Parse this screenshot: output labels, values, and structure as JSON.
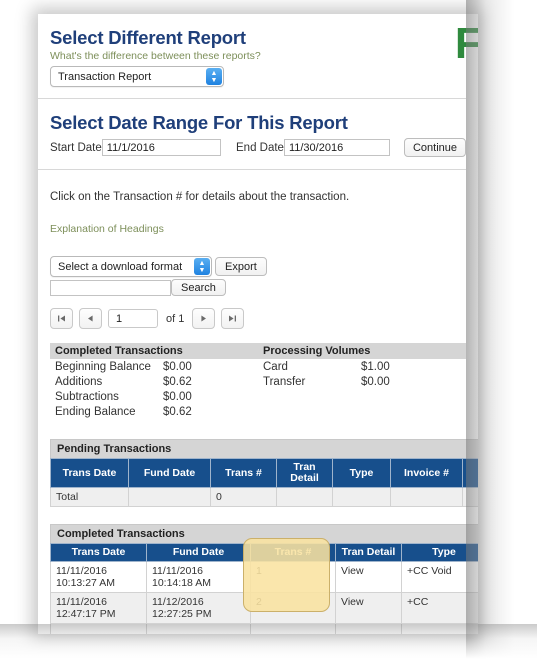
{
  "logo": {
    "text": "Fi"
  },
  "report_selector": {
    "heading": "Select Different Report",
    "help_link": "What's the difference between these reports?",
    "selected_report": "Transaction Report"
  },
  "date_range": {
    "heading": "Select Date Range For This Report",
    "start_label": "Start Date",
    "start_value": "11/1/2016",
    "end_label": "End Date",
    "end_value": "11/30/2016",
    "continue_label": "Continue"
  },
  "instruction": "Click on the Transaction # for details about the transaction.",
  "explanation_link": "Explanation of Headings",
  "toolbar": {
    "download_format": "Select a download format",
    "export_label": "Export",
    "search_value": "",
    "search_label": "Search"
  },
  "pager": {
    "first": "|◀",
    "prev": "◀",
    "page": "1",
    "of": "of 1",
    "next": "▶",
    "last": "▶|"
  },
  "summary": {
    "completed": {
      "title": "Completed Transactions",
      "rows": [
        {
          "label": "Beginning Balance",
          "value": "$0.00"
        },
        {
          "label": "Additions",
          "value": "$0.62"
        },
        {
          "label": "Subtractions",
          "value": "$0.00"
        },
        {
          "label": "Ending Balance",
          "value": "$0.62"
        }
      ]
    },
    "volumes": {
      "title": "Processing Volumes",
      "rows": [
        {
          "label": "Card",
          "value": "$1.00"
        },
        {
          "label": "Transfer",
          "value": "$0.00"
        }
      ]
    }
  },
  "pending_table": {
    "caption": "Pending Transactions",
    "columns": [
      "Trans Date",
      "Fund Date",
      "Trans #",
      "Tran Detail",
      "Type",
      "Invoice #",
      ""
    ],
    "rows": [
      [
        "Total",
        "",
        "0",
        "",
        "",
        "",
        ""
      ]
    ]
  },
  "completed_table": {
    "caption": "Completed Transactions",
    "columns": [
      "Trans Date",
      "Fund Date",
      "Trans #",
      "Tran Detail",
      "Type"
    ],
    "rows": [
      {
        "trans_date": "11/11/2016 10:13:27 AM",
        "fund_date": "11/11/2016 10:14:18 AM",
        "trans_num": "1",
        "tran_detail": "View",
        "type": "+CC Void"
      },
      {
        "trans_date": "11/11/2016 12:47:17 PM",
        "fund_date": "11/12/2016 12:27:25 PM",
        "trans_num": "2",
        "tran_detail": "View",
        "type": "+CC"
      }
    ]
  },
  "colors": {
    "heading": "#1f3f7a",
    "link_green": "#7d8f5a",
    "table_header": "#174f8c",
    "highlight": "#f9e2a0",
    "logo_green": "#2f8a3e"
  }
}
